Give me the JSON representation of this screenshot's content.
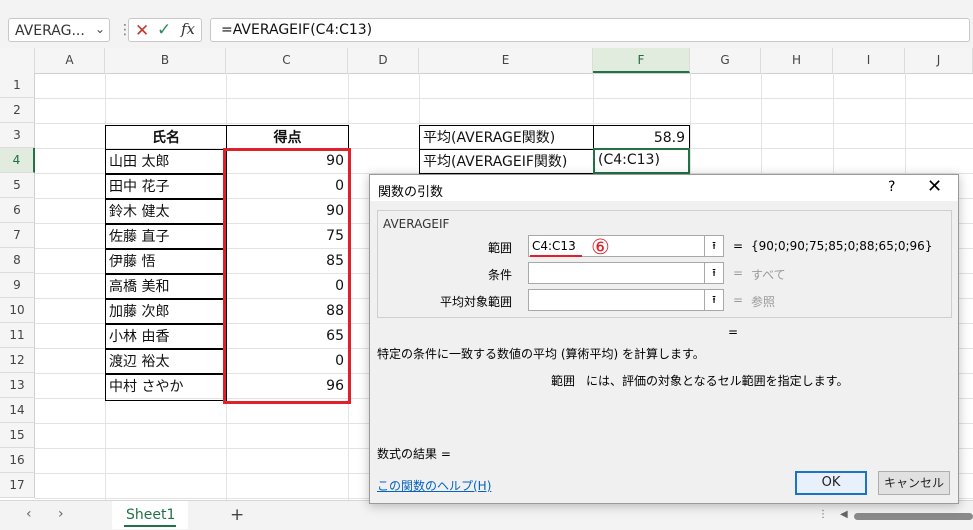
{
  "formula_bar": {
    "name_box": "AVERAG...",
    "cancel_icon": "cross-icon",
    "enter_icon": "check-icon",
    "fx_label": "fx",
    "formula": "=AVERAGEIF(C4:C13)"
  },
  "columns": [
    "A",
    "B",
    "C",
    "D",
    "E",
    "F",
    "G",
    "H",
    "I",
    "J"
  ],
  "selected_column": "F",
  "rows": [
    "1",
    "2",
    "3",
    "4",
    "5",
    "6",
    "7",
    "8",
    "9",
    "10",
    "11",
    "12",
    "13",
    "14",
    "15",
    "16",
    "17"
  ],
  "selected_row": "4",
  "table": {
    "header_name": "氏名",
    "header_score": "得点",
    "entries": [
      {
        "name": "山田 太郎",
        "score": "90"
      },
      {
        "name": "田中 花子",
        "score": "0"
      },
      {
        "name": "鈴木 健太",
        "score": "90"
      },
      {
        "name": "佐藤 直子",
        "score": "75"
      },
      {
        "name": "伊藤 悟",
        "score": "85"
      },
      {
        "name": "高橋 美和",
        "score": "0"
      },
      {
        "name": "加藤 次郎",
        "score": "88"
      },
      {
        "name": "小林 由香",
        "score": "65"
      },
      {
        "name": "渡辺 裕太",
        "score": "0"
      },
      {
        "name": "中村 さやか",
        "score": "96"
      }
    ]
  },
  "summary": {
    "avg_label": "平均(AVERAGE関数)",
    "avg_value": "58.9",
    "avgif_label": "平均(AVERAGEIF関数)",
    "avgif_value": "(C4:C13)"
  },
  "dialog": {
    "title": "関数の引数",
    "help": "?",
    "close": "✕",
    "function_name": "AVERAGEIF",
    "args": [
      {
        "label": "範囲",
        "value": "C4:C13",
        "result": "{90;0;90;75;85;0;88;65;0;96}",
        "result_gray": false
      },
      {
        "label": "条件",
        "value": "",
        "result": "すべて",
        "result_gray": true
      },
      {
        "label": "平均対象範囲",
        "value": "",
        "result": "参照",
        "result_gray": true
      }
    ],
    "annotation": "⑥",
    "eq_sign": "=",
    "description": "特定の条件に一致する数値の平均 (算術平均) を計算します。",
    "arg_name": "範囲",
    "arg_description": "には、評価の対象となるセル範囲を指定します。",
    "result_label": "数式の結果 =",
    "help_link": "この関数のヘルプ(H)",
    "ok": "OK",
    "cancel": "キャンセル"
  },
  "sheets": {
    "active": "Sheet1",
    "prev_icon": "‹",
    "next_icon": "›",
    "add": "+"
  },
  "colors": {
    "highlight_red": "#e0202a",
    "excel_green": "#217346",
    "link_blue": "#0563c1"
  }
}
